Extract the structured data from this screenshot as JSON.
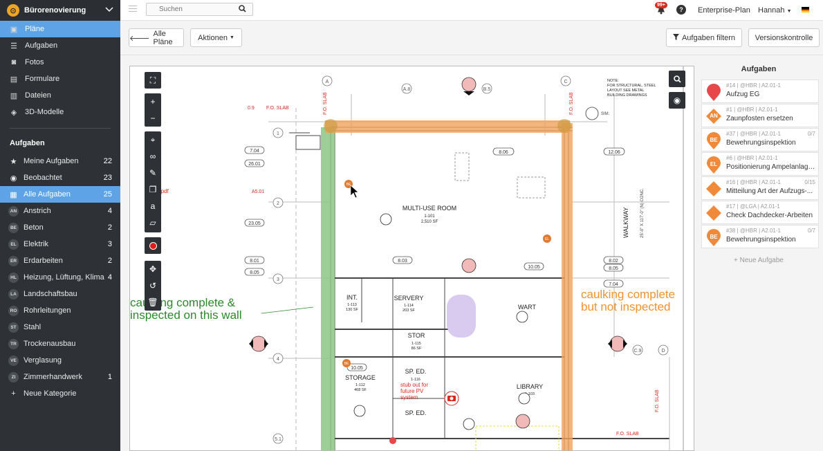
{
  "project": {
    "name": "Bürorenovierung"
  },
  "nav": [
    {
      "label": "Pläne",
      "icon": "plans-icon",
      "active": true
    },
    {
      "label": "Aufgaben",
      "icon": "list-icon"
    },
    {
      "label": "Fotos",
      "icon": "camera-icon"
    },
    {
      "label": "Formulare",
      "icon": "clipboard-icon"
    },
    {
      "label": "Dateien",
      "icon": "file-icon"
    },
    {
      "label": "3D-Modelle",
      "icon": "cube-icon"
    }
  ],
  "tasks_section": {
    "title": "Aufgaben",
    "items": [
      {
        "label": "Meine Aufgaben",
        "count": "22",
        "icon": "star-icon"
      },
      {
        "label": "Beobachtet",
        "count": "23",
        "icon": "eye-icon"
      },
      {
        "label": "Alle Aufgaben",
        "count": "25",
        "icon": "grid-icon",
        "active": true
      },
      {
        "badge": "AN",
        "label": "Anstrich",
        "count": "4"
      },
      {
        "badge": "BE",
        "label": "Beton",
        "count": "2"
      },
      {
        "badge": "EL",
        "label": "Elektrik",
        "count": "3"
      },
      {
        "badge": "ER",
        "label": "Erdarbeiten",
        "count": "2"
      },
      {
        "badge": "HL",
        "label": "Heizung, Lüftung, Klima",
        "count": "4"
      },
      {
        "badge": "LA",
        "label": "Landschaftsbau",
        "count": ""
      },
      {
        "badge": "RO",
        "label": "Rohrleitungen",
        "count": ""
      },
      {
        "badge": "ST",
        "label": "Stahl",
        "count": ""
      },
      {
        "badge": "TR",
        "label": "Trockenausbau",
        "count": ""
      },
      {
        "badge": "VE",
        "label": "Verglasung",
        "count": ""
      },
      {
        "badge": "ZI",
        "label": "Zimmerhandwerk",
        "count": "1"
      },
      {
        "label": "Neue Kategorie",
        "count": "",
        "icon": "plus-icon"
      }
    ]
  },
  "topbar": {
    "search_placeholder": "Suchen",
    "notifications": "99+",
    "help": "?",
    "plan": "Enterprise-Plan",
    "user": "Hannah",
    "colors": {
      "flag": [
        "#000000",
        "#dd0000",
        "#ffce00"
      ]
    }
  },
  "toolbar": {
    "back": "Alle Pläne",
    "actions": "Aktionen",
    "filter": "Aufgaben filtern",
    "versions": "Versionskontrolle"
  },
  "plan": {
    "room_labels": [
      "MULTI-USE ROOM",
      "INT.",
      "SERVERY",
      "STOR",
      "STORAGE",
      "SP. ED.",
      "WART",
      "LIBRARY",
      "WALKWAY"
    ],
    "room_numbers": [
      "1-101",
      "2,510 SF",
      "1-113",
      "130 SF",
      "1-114",
      "203 SF",
      "1-115",
      "86 SF",
      "1-112",
      "468 SF",
      "1-116",
      "1-103"
    ],
    "callouts": [
      "7.04",
      "26.01",
      "23.05",
      "8.01",
      "8.05",
      "8.06",
      "8.03",
      "10.05",
      "12.06",
      "8.02",
      "8.05",
      "7.04",
      "10.05",
      "10.05"
    ],
    "grid_labels": [
      "A",
      "C",
      "1",
      "2",
      "3",
      "4",
      "5.1",
      "A.8",
      "B.5",
      "D",
      "C.9"
    ],
    "notes": {
      "green": "caulking complete & inspected on this wall",
      "orange": "caulking complete but not inspected",
      "red": "stub out for future PV system",
      "slab_left": "F.O. SLAB",
      "slab_bottom": "F.O. SLAB",
      "general": "NOTE: FOR STRUCTURAL, STEEL LAYOUT SEE METAL BUILDING DRAWINGS",
      "walkway_dim": "25'-0\" X 117'-0\" (N) CONC.",
      "file_ref": "onse.pdf",
      "sheet_ref": "A5.01",
      "elev_label": "0.9",
      "sim": "SIM."
    },
    "markers": [
      {
        "code": "BE",
        "color": "#e07a2e"
      },
      {
        "code": "EL",
        "color": "#e07a2e"
      },
      {
        "code": "BE",
        "color": "#e07a2e"
      }
    ]
  },
  "tasks_panel": {
    "title": "Aufgaben",
    "items": [
      {
        "meta": "#14 | @HBR | A2.01-1",
        "name": "Aufzug EG",
        "marker": "pin",
        "color": "#e8474a",
        "progress": ""
      },
      {
        "meta": "#1 | @HBR | A2.01-1",
        "name": "Zaunpfosten ersetzen",
        "marker": "diamond",
        "badge": "AN",
        "color": "#f08a3a",
        "progress": ""
      },
      {
        "meta": "#37 | @HBR | A2.01-1",
        "name": "Bewehrungsinspektion",
        "marker": "pin",
        "badge": "BE",
        "color": "#f08a3a",
        "progress": "0/7"
      },
      {
        "meta": "#6 | @HBR | A2.01-1",
        "name": "Positionierung Ampelanlage ...",
        "marker": "pin",
        "badge": "EL",
        "color": "#f08a3a",
        "progress": ""
      },
      {
        "meta": "#16 | @HBR | A2.01-1",
        "name": "Mitteilung Art der Aufzugs-...",
        "marker": "diamond",
        "color": "#f08a3a",
        "progress": "0/15"
      },
      {
        "meta": "#17 | @LGA | A2.01-1",
        "name": "Check Dachdecker-Arbeiten",
        "marker": "diamond",
        "color": "#f08a3a",
        "progress": ""
      },
      {
        "meta": "#38 | @HBR | A2.01-1",
        "name": "Bewehrungsinspektion",
        "marker": "pin",
        "badge": "BE",
        "color": "#f08a3a",
        "progress": "0/7"
      }
    ],
    "add_label": "+ Neue Aufgabe"
  }
}
